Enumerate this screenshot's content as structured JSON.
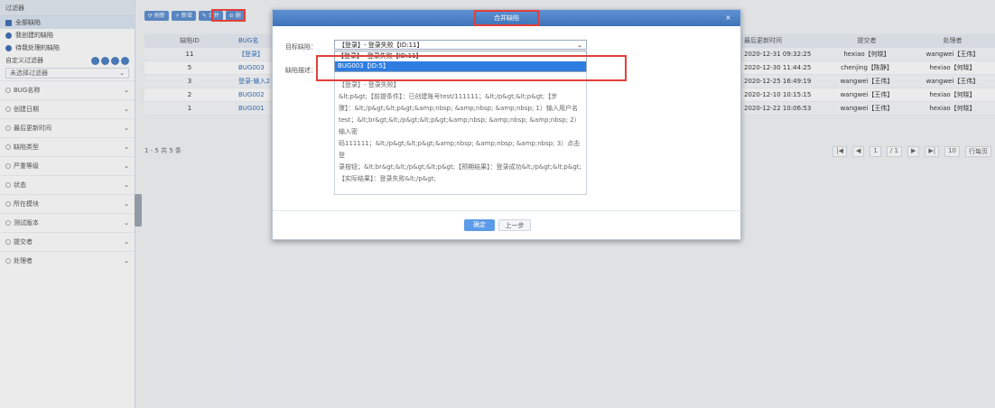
{
  "sidebar": {
    "title": "过滤器",
    "links": [
      {
        "label": "全部缺陷",
        "color": "#3d6fb6"
      },
      {
        "label": "我创建的缺陷",
        "color": "#3d6fb6"
      },
      {
        "label": "待我处理的缺陷",
        "color": "#3d6fb6"
      }
    ],
    "filter_label": "自定义过滤器",
    "filter_select": "未选择过滤器",
    "groups": [
      "BUG名称",
      "创建日期",
      "最后更新时间",
      "缺陷类型",
      "严重等级",
      "状态",
      "所在模块",
      "测试版本",
      "提交者",
      "处理者"
    ]
  },
  "toolbar": {
    "buttons": [
      "⟳ 刷新",
      "+ 新增",
      "✎ 合并",
      "⊘ 删"
    ]
  },
  "table": {
    "headers": {
      "id": "缺陷ID",
      "title": "BUG名",
      "time": "最后更新时间",
      "submitter": "提交者",
      "processor": "处理者"
    },
    "rows": [
      {
        "id": "11",
        "title": "【登录】",
        "time": "2020-12-31 09:32:25",
        "submitter": "hexiao【何晓】",
        "processor": "wangwei【王伟】"
      },
      {
        "id": "5",
        "title": "BUG003",
        "time": "2020-12-30 11:44:25",
        "submitter": "chenjing【陈静】",
        "processor": "hexiao【何晓】"
      },
      {
        "id": "3",
        "title": "登录-输入2",
        "time": "2020-12-25 16:49:19",
        "submitter": "wangwei【王伟】",
        "processor": "wangwei【王伟】"
      },
      {
        "id": "2",
        "title": "BUG002",
        "time": "2020-12-10 10:15:15",
        "submitter": "wangwei【王伟】",
        "processor": "hexiao【何晓】"
      },
      {
        "id": "1",
        "title": "BUG001",
        "time": "2020-12-22 10:06:53",
        "submitter": "wangwei【王伟】",
        "processor": "hexiao【何晓】"
      }
    ],
    "pager_left": "1 - 5 共 5 条",
    "pager_right": [
      "|◀",
      "◀",
      "1",
      "/ 1",
      "▶",
      "▶|",
      "10",
      "行每页"
    ]
  },
  "modal": {
    "title": "合并缺陷",
    "close": "×",
    "label_target": "目标缺陷：",
    "label_desc": "缺陷描述：",
    "select_value": "【登录】- 登录失败【ID:11】",
    "dropdown_options": [
      "【登录】- 登录失败【ID:11】",
      "BUG003【ID:5】"
    ],
    "desc_lines": [
      "【登录】- 登录失败】",
      "&lt;p&gt;【前提条件】：已创建账号test/111111；&lt;/p&gt;&lt;p&gt;【步",
      "骤】：&lt;/p&gt;&lt;p&gt;&amp;nbsp; &amp;nbsp; &amp;nbsp; 1）输入用户名",
      "test；&lt;br&gt;&lt;/p&gt;&lt;p&gt;&amp;nbsp; &amp;nbsp; &amp;nbsp; 2）输入密",
      "码111111；&lt;/p&gt;&lt;p&gt;&amp;nbsp; &amp;nbsp; &amp;nbsp; 3）点击登",
      "录按钮；&lt;br&gt;&lt;/p&gt;&lt;p&gt;【预期结果】：登录成功&lt;/p&gt;&lt;p&gt;",
      "【实际结果】：登录失败&lt;/p&gt;"
    ],
    "ok_label": "确定",
    "prev_label": "上一步"
  }
}
